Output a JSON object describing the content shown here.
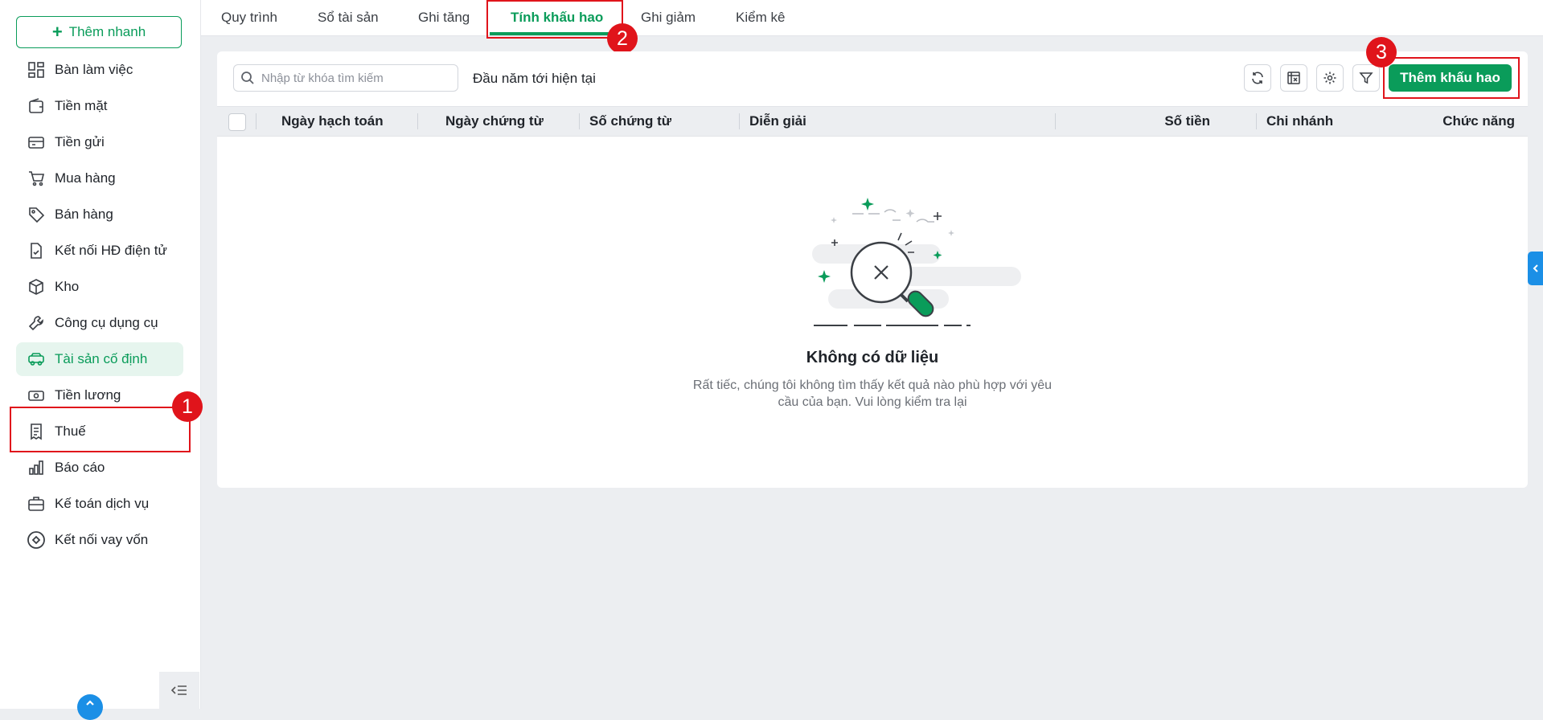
{
  "quick_add": {
    "label": "Thêm nhanh",
    "icon": "plus-icon"
  },
  "sidebar": {
    "items": [
      {
        "label": "Bàn làm việc",
        "icon": "dashboard-icon"
      },
      {
        "label": "Tiền mặt",
        "icon": "wallet-icon"
      },
      {
        "label": "Tiền gửi",
        "icon": "bank-card-icon"
      },
      {
        "label": "Mua hàng",
        "icon": "cart-icon"
      },
      {
        "label": "Bán hàng",
        "icon": "tag-icon"
      },
      {
        "label": "Kết nối HĐ điện tử",
        "icon": "document-check-icon"
      },
      {
        "label": "Kho",
        "icon": "box-icon"
      },
      {
        "label": "Công cụ dụng cụ",
        "icon": "wrench-icon"
      },
      {
        "label": "Tài sản cố định",
        "icon": "truck-icon",
        "active": true
      },
      {
        "label": "Tiền lương",
        "icon": "cash-icon"
      },
      {
        "label": "Thuế",
        "icon": "receipt-icon"
      },
      {
        "label": "Báo cáo",
        "icon": "bar-chart-icon"
      },
      {
        "label": "Kế toán dịch vụ",
        "icon": "briefcase-icon"
      },
      {
        "label": "Kết nối vay vốn",
        "icon": "link-circle-icon"
      }
    ]
  },
  "tabs": [
    {
      "label": "Quy trình"
    },
    {
      "label": "Sổ tài sản"
    },
    {
      "label": "Ghi tăng"
    },
    {
      "label": "Tính khấu hao",
      "active": true
    },
    {
      "label": "Ghi giảm"
    },
    {
      "label": "Kiểm kê"
    }
  ],
  "toolbar": {
    "search_placeholder": "Nhập từ khóa tìm kiếm",
    "period": "Đầu năm tới hiện tại",
    "add_label": "Thêm khấu hao"
  },
  "table": {
    "columns": [
      "Ngày hạch toán",
      "Ngày chứng từ",
      "Số chứng từ",
      "Diễn giải",
      "Số tiền",
      "Chi nhánh",
      "Chức năng"
    ],
    "rows": []
  },
  "empty": {
    "title": "Không có dữ liệu",
    "description_line1": "Rất tiếc, chúng tôi không tìm thấy kết quả nào phù hợp với yêu",
    "description_line2": "cầu của bạn. Vui lòng kiểm tra lại"
  },
  "annotations": [
    "1",
    "2",
    "3"
  ],
  "colors": {
    "accent": "#0a9c5a",
    "highlight": "#e0141b",
    "blue": "#1b8fe6"
  }
}
